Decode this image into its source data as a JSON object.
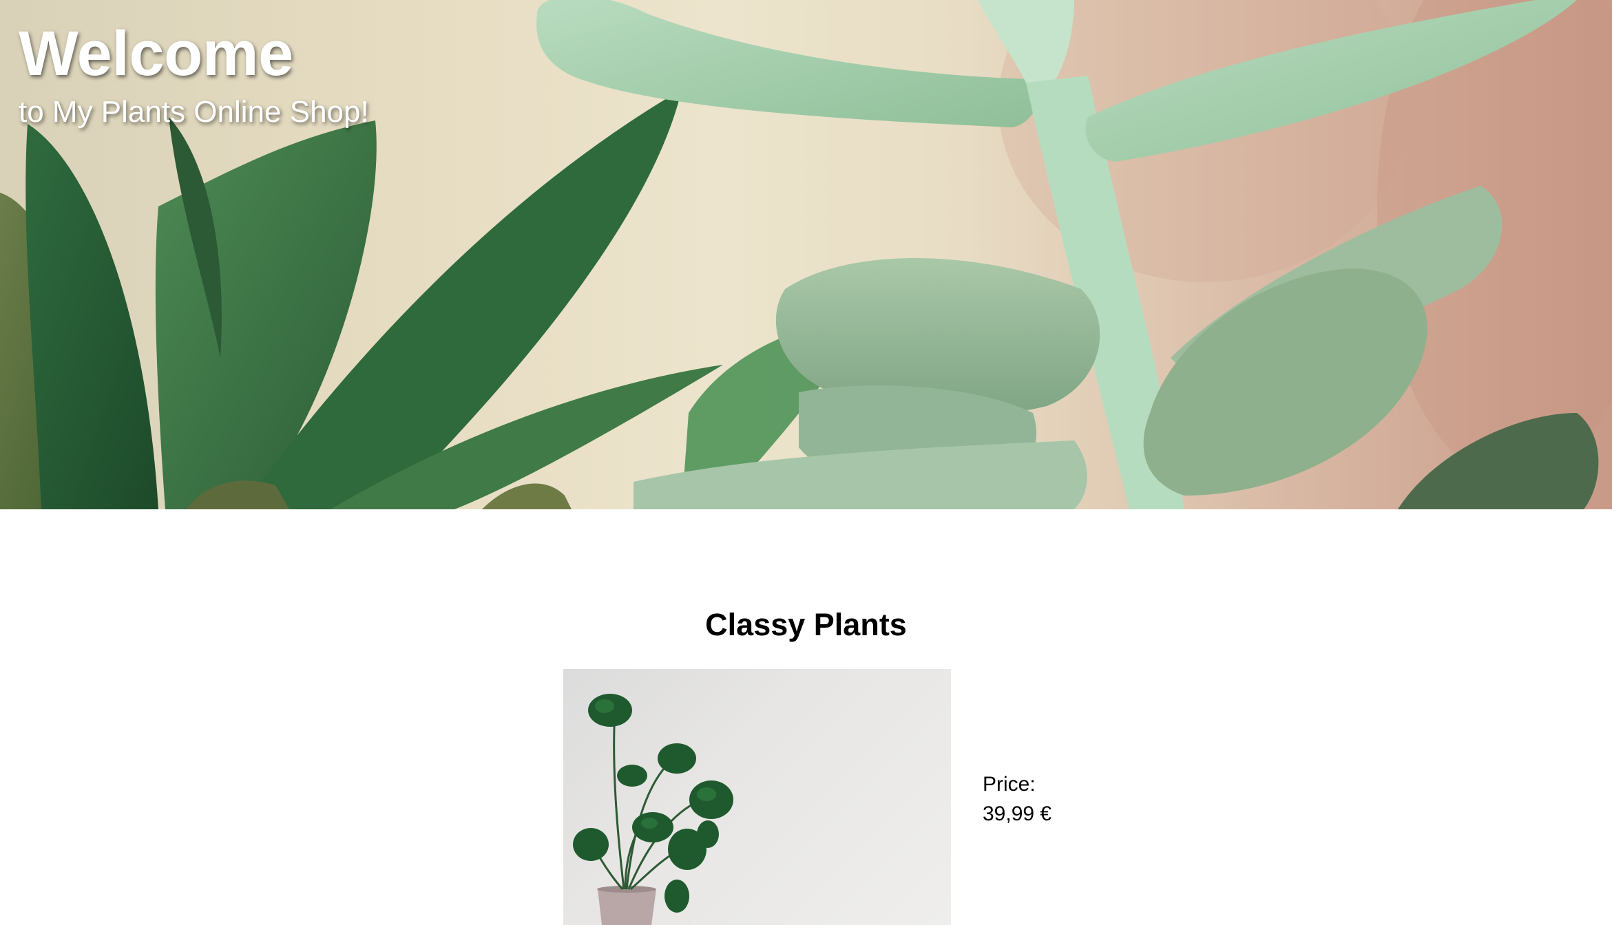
{
  "hero": {
    "title": "Welcome",
    "subtitle": "to My Plants Online Shop!",
    "image": "succulent-plants-banner"
  },
  "section": {
    "title": "Classy Plants"
  },
  "product": {
    "image": "monstera-plant-photo",
    "price_label": "Price:",
    "price_value": "39,99 €"
  },
  "colors": {
    "background": "#ffffff",
    "text": "#000000",
    "hero_text": "#ffffff"
  }
}
